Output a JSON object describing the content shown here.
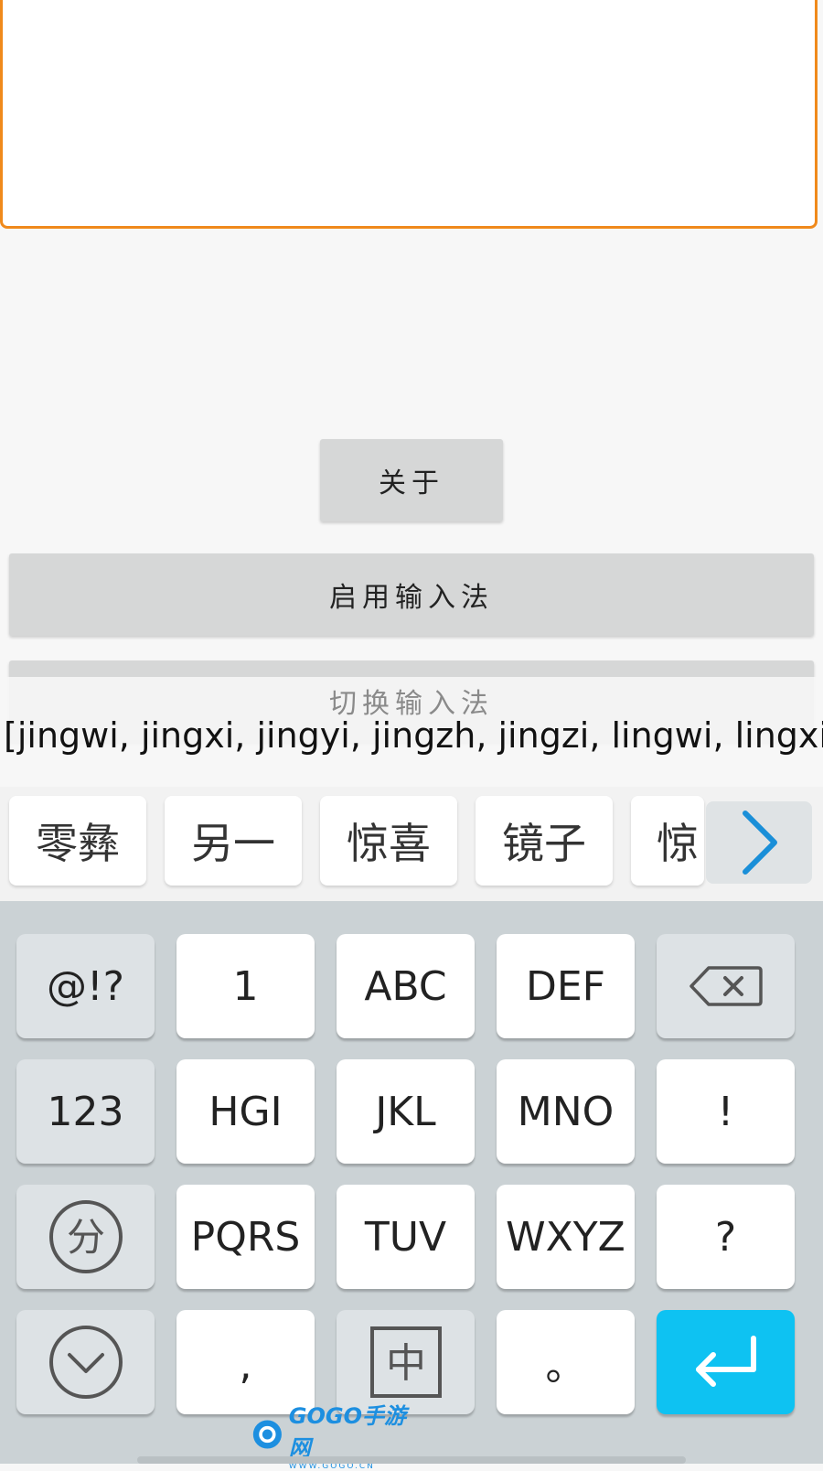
{
  "buttons": {
    "about": "关于",
    "enable_ime": "启用输入法",
    "switch_ime": "切换输入法"
  },
  "composing": {
    "pinyin_text": "[jingwi, jingxi, jingyi, jingzh, jingzi, lingwi, lingxi, lin"
  },
  "candidates": [
    "零彝",
    "另一",
    "惊喜",
    "镜子",
    "惊"
  ],
  "keyboard": {
    "row1": [
      "@!?",
      "1",
      "ABC",
      "DEF"
    ],
    "row2": [
      "123",
      "HGI",
      "JKL",
      "MNO",
      "!"
    ],
    "row3": [
      "PQRS",
      "TUV",
      "WXYZ",
      "?"
    ],
    "row4": [
      ",",
      "。"
    ],
    "icons": {
      "backspace": "backspace-icon",
      "fen": "分",
      "hide": "chevron-down-icon",
      "zh": "中",
      "enter": "enter-icon",
      "more": "chevron-right-icon"
    }
  },
  "watermark": {
    "brand": "GOGO手游网",
    "url": "WWW.GOGO.CN"
  },
  "colors": {
    "accent_orange": "#f08a1c",
    "enter_blue": "#0ec2f2",
    "keyboard_bg": "#cbd2d5"
  }
}
